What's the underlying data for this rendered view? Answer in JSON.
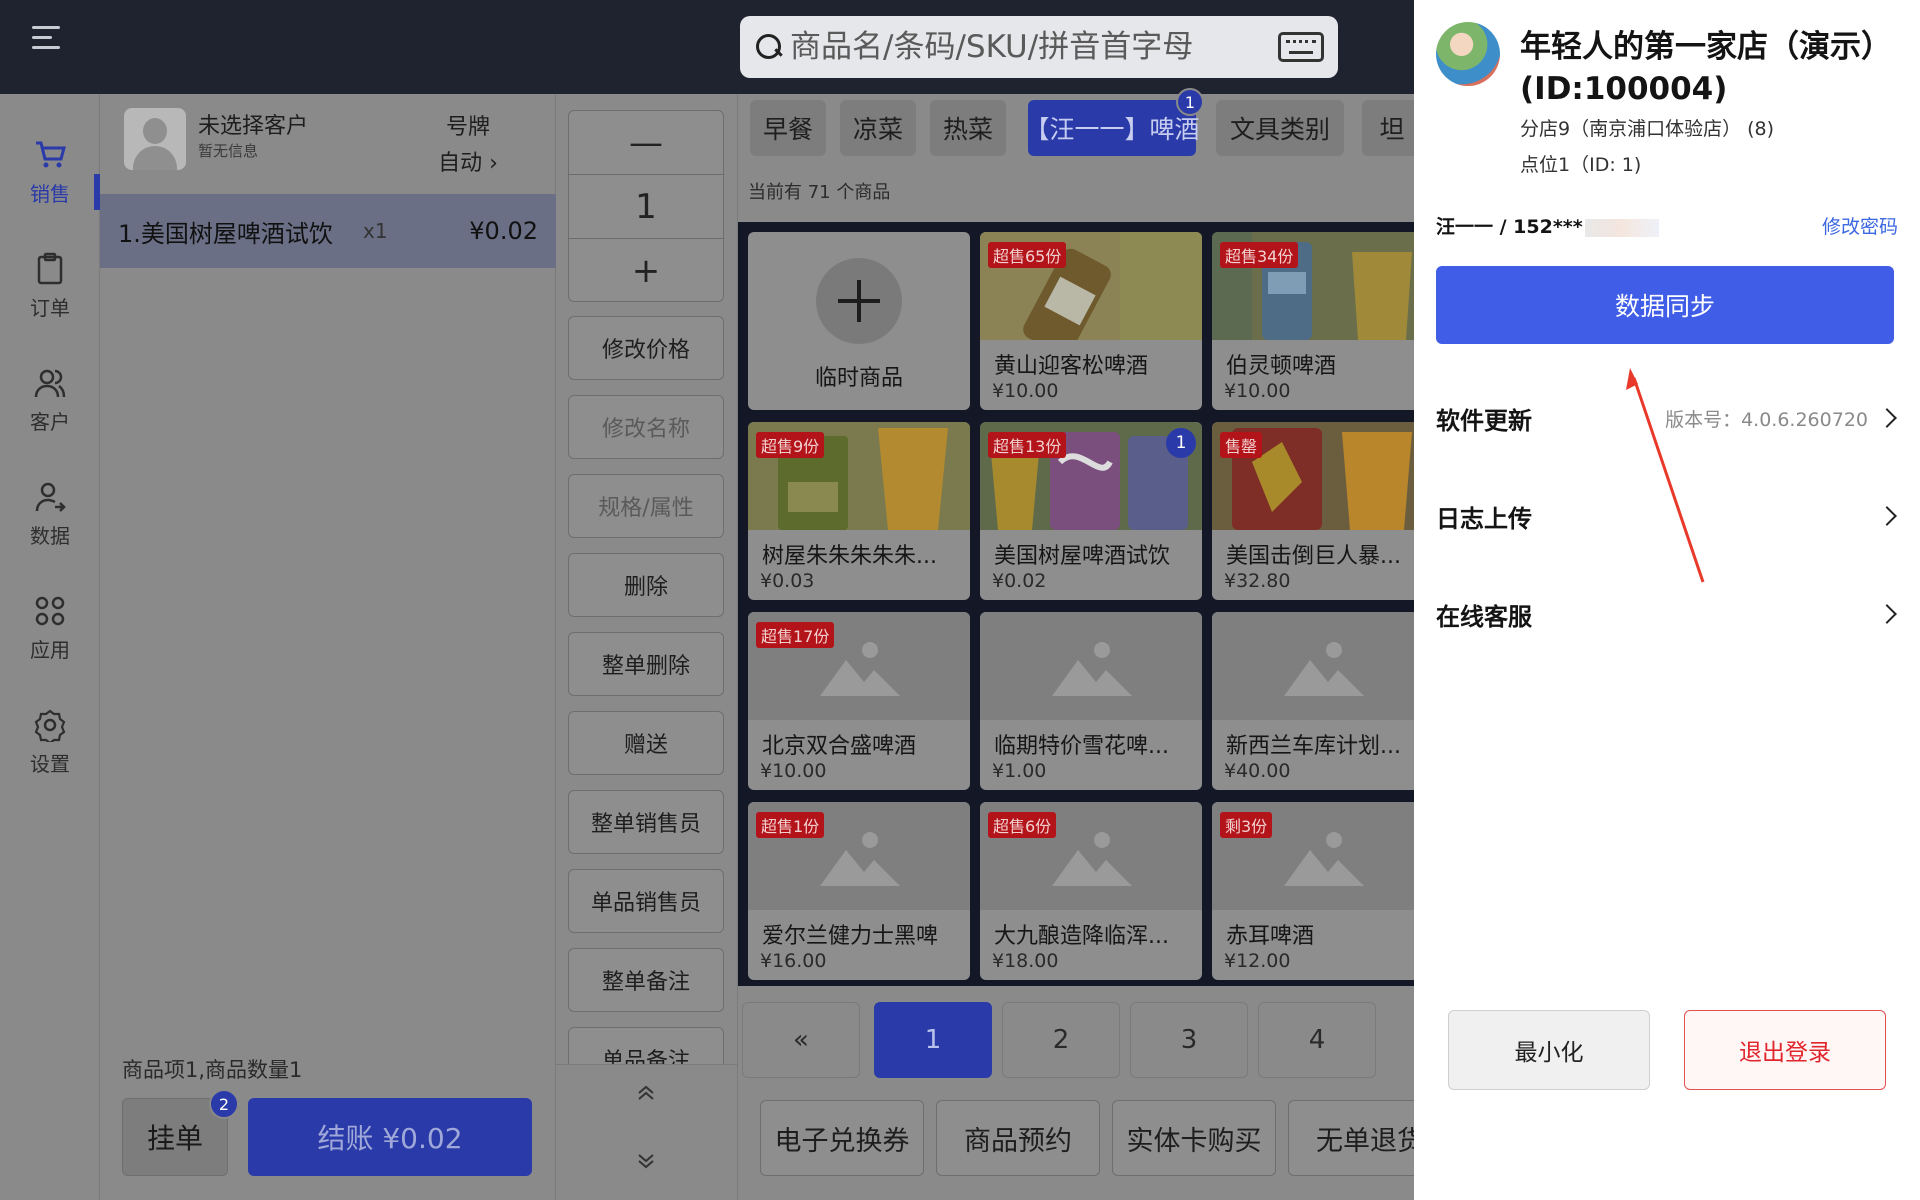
{
  "search": {
    "placeholder": "商品名/条码/SKU/拼音首字母"
  },
  "nav": {
    "items": [
      {
        "label": "销售",
        "icon": "cart-icon",
        "active": true
      },
      {
        "label": "订单",
        "icon": "clipboard-icon"
      },
      {
        "label": "客户",
        "icon": "users-icon"
      },
      {
        "label": "数据",
        "icon": "user-data-icon"
      },
      {
        "label": "应用",
        "icon": "apps-grid-icon"
      },
      {
        "label": "设置",
        "icon": "gear-icon"
      }
    ]
  },
  "customer": {
    "name": "未选择客户",
    "sub": "暂无信息",
    "tag_title": "号牌",
    "tag_value": "自动 ›"
  },
  "order": {
    "lines": [
      {
        "name": "1.美国树屋啤酒试饮",
        "qty": "x1",
        "price": "¥0.02"
      }
    ],
    "summary": "商品项1,商品数量1",
    "hold_label": "挂单",
    "hold_count": "2",
    "checkout_label": "结账 ¥0.02"
  },
  "stepper": {
    "minus": "—",
    "value": "1",
    "plus": "+"
  },
  "actions": [
    {
      "label": "修改价格"
    },
    {
      "label": "修改名称",
      "disabled": true
    },
    {
      "label": "规格/属性",
      "disabled": true
    },
    {
      "label": "删除"
    },
    {
      "label": "整单删除"
    },
    {
      "label": "赠送"
    },
    {
      "label": "整单销售员"
    },
    {
      "label": "单品销售员"
    },
    {
      "label": "整单备注"
    },
    {
      "label": "单品备注"
    }
  ],
  "categories": [
    {
      "label": "早餐"
    },
    {
      "label": "凉菜"
    },
    {
      "label": "热菜"
    },
    {
      "label": "【汪一一】啤酒",
      "active": true,
      "badge": "1"
    },
    {
      "label": "文具类别"
    },
    {
      "label": "坦"
    }
  ],
  "product_count": "当前有 71 个商品",
  "products": [
    {
      "temp": true,
      "name": "临时商品"
    },
    {
      "name": "黄山迎客松啤酒",
      "price": "¥10.00",
      "flag": "超售65份",
      "img": "bottle"
    },
    {
      "name": "伯灵顿啤酒",
      "price": "¥10.00",
      "flag": "超售34份",
      "img": "can-blue"
    },
    {
      "name": "树屋朱朱朱朱朱...",
      "price": "¥0.03",
      "flag": "超售9份",
      "img": "can-green"
    },
    {
      "name": "美国树屋啤酒试饮",
      "price": "¥0.02",
      "flag": "超售13份",
      "img": "can-multi",
      "badge": "1"
    },
    {
      "name": "美国击倒巨人暴...",
      "price": "¥32.80",
      "flag": "售罄",
      "img": "can-red"
    },
    {
      "name": "北京双合盛啤酒",
      "price": "¥10.00",
      "flag": "超售17份"
    },
    {
      "name": "临期特价雪花啤...",
      "price": "¥1.00"
    },
    {
      "name": "新西兰车库计划...",
      "price": "¥40.00"
    },
    {
      "name": "爱尔兰健力士黑啤",
      "price": "¥16.00",
      "flag": "超售1份"
    },
    {
      "name": "大九酿造降临浑...",
      "price": "¥18.00",
      "flag": "超售6份"
    },
    {
      "name": "赤耳啤酒",
      "price": "¥12.00",
      "flag": "剩3份"
    }
  ],
  "pager": {
    "prev": "«",
    "pages": [
      "1",
      "2",
      "3",
      "4"
    ],
    "active": "1"
  },
  "functions": [
    {
      "label": "电子兑换券"
    },
    {
      "label": "商品预约"
    },
    {
      "label": "实体卡购买"
    },
    {
      "label": "无单退货"
    }
  ],
  "drawer": {
    "store_name": "年轻人的第一家店（演示）(ID:100004)",
    "branch": "分店9（南京浦口体验店） (8)",
    "point": "点位1（ID: 1)",
    "user": "汪一一 / 152***",
    "change_password": "修改密码",
    "sync_label": "数据同步",
    "rows": [
      {
        "label": "软件更新",
        "value": "版本号：4.0.6.260720"
      },
      {
        "label": "日志上传",
        "value": ""
      },
      {
        "label": "在线客服",
        "value": ""
      }
    ],
    "minimize_label": "最小化",
    "logout_label": "退出登录"
  },
  "colors": {
    "accent": "#2a3aa8",
    "drawer_accent": "#3f5de6",
    "danger": "#e0262c",
    "flag": "#b3141a"
  }
}
